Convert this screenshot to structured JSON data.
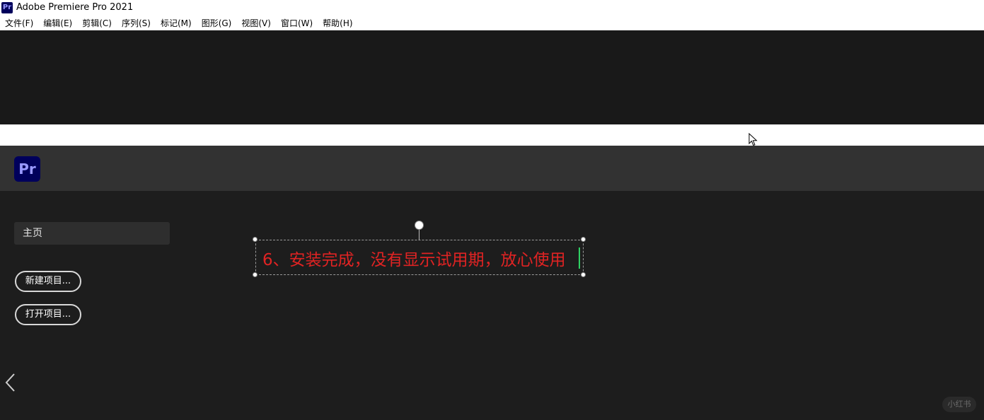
{
  "window": {
    "app_icon": "Pr",
    "title": "Adobe Premiere Pro 2021"
  },
  "menu": [
    "文件(F)",
    "编辑(E)",
    "剪辑(C)",
    "序列(S)",
    "标记(M)",
    "图形(G)",
    "视图(V)",
    "窗口(W)",
    "帮助(H)"
  ],
  "home": {
    "logo": "Pr",
    "nav_home": "主页",
    "new_project": "新建项目...",
    "open_project": "打开项目..."
  },
  "overlay": {
    "caption": "6、安装完成，没有显示试用期，放心使用"
  },
  "watermark": "小红书",
  "colors": {
    "caption_red": "#e02323",
    "logo_bg": "#00005b",
    "logo_text": "#9999ff",
    "caret": "#2fd163"
  }
}
